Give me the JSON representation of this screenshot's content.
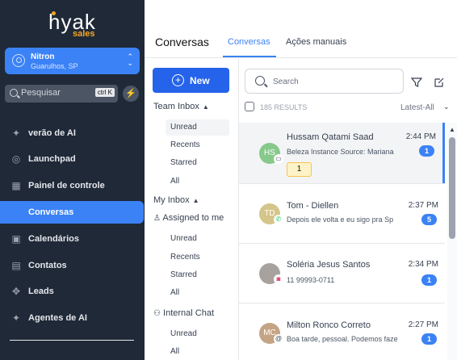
{
  "brand": {
    "logo_main": "hyak",
    "logo_sub": "sales"
  },
  "location": {
    "name": "Nitron",
    "city": "Guarulhos, SP"
  },
  "search": {
    "placeholder": "Pesquisar",
    "shortcut": "ctrl K"
  },
  "nav": [
    {
      "label": "verão de AI",
      "icon": "sparkle-icon"
    },
    {
      "label": "Launchpad",
      "icon": "rocket-icon"
    },
    {
      "label": "Painel de controle",
      "icon": "dashboard-icon"
    },
    {
      "label": "Conversas",
      "icon": "chat-icon"
    },
    {
      "label": "Calendários",
      "icon": "calendar-icon"
    },
    {
      "label": "Contatos",
      "icon": "contacts-icon"
    },
    {
      "label": "Leads",
      "icon": "leads-icon"
    },
    {
      "label": "Agentes de AI",
      "icon": "sparkle-icon"
    }
  ],
  "header": {
    "title": "Conversas",
    "tabs": [
      "Conversas",
      "Ações manuais"
    ]
  },
  "middle": {
    "new_label": "New",
    "team_inbox": "Team Inbox",
    "team_items": [
      "Unread",
      "Recents",
      "Starred",
      "All"
    ],
    "my_inbox": "My Inbox",
    "assigned": "Assigned to me",
    "assigned_items": [
      "Unread",
      "Recents",
      "Starred",
      "All"
    ],
    "internal": "Internal Chat",
    "internal_items": [
      "Unread",
      "All"
    ]
  },
  "list": {
    "search_placeholder": "Search",
    "results": "185 RESULTS",
    "sort": "Latest-All",
    "conversations": [
      {
        "initials": "HS",
        "name": "Hussam Qatami Saad",
        "message": "Beleza Instance Source: Mariana",
        "time": "2:44 PM",
        "count": "1",
        "tag": "1",
        "avatar_color": "#86c98a",
        "channel": "chat"
      },
      {
        "initials": "TD",
        "name": "Tom - Diellen",
        "message": "Depois ele volta e eu sigo pra Sp",
        "time": "2:37 PM",
        "count": "5",
        "avatar_color": "#d4c58a",
        "channel": "whatsapp"
      },
      {
        "initials": "",
        "name": "Soléria Jesus Santos",
        "message": "11 99993-0711",
        "time": "2:34 PM",
        "count": "1",
        "avatar_color": "#a8a29e",
        "channel": "instagram"
      },
      {
        "initials": "MC",
        "name": "Milton Ronco Correto",
        "message": "Boa tarde, pessoal. Podemos fazer",
        "time": "2:27 PM",
        "count": "1",
        "avatar_color": "#c4a484",
        "channel": "email"
      }
    ]
  },
  "colors": {
    "accent": "#3b82f6",
    "sidebar": "#1f2937"
  }
}
